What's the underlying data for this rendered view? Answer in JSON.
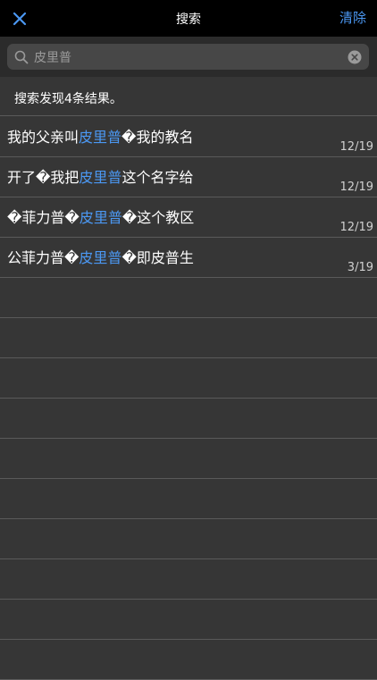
{
  "nav": {
    "close_icon": "close-icon",
    "title": "搜索",
    "clear_label": "清除",
    "accent_color": "#4b98f3"
  },
  "search": {
    "value": "皮里普",
    "placeholder": "",
    "search_icon": "search-icon",
    "clear_icon": "clear-circle-icon"
  },
  "summary": "搜索发现4条结果。",
  "results": [
    {
      "before": "我的父亲叫",
      "highlight": "皮里普",
      "after": "�我的教名",
      "meta": "12/19"
    },
    {
      "before": "开了�我把",
      "highlight": "皮里普",
      "after": "这个名字给",
      "meta": "12/19"
    },
    {
      "before": "�菲力普�",
      "highlight": "皮里普",
      "after": "�这个教区",
      "meta": "12/19"
    },
    {
      "before": "公菲力普�",
      "highlight": "皮里普",
      "after": "�即皮普生",
      "meta": "3/19"
    }
  ]
}
